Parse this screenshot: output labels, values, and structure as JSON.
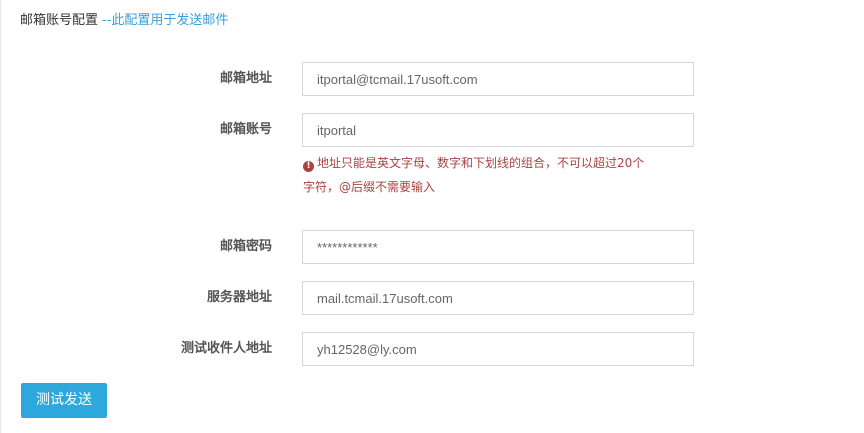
{
  "header": {
    "title": "邮箱账号配置",
    "subtitle": "--此配置用于发送邮件"
  },
  "form": {
    "email_address": {
      "label": "邮箱地址",
      "value": "itportal@tcmail.17usoft.com"
    },
    "email_account": {
      "label": "邮箱账号",
      "value": "itportal",
      "error_line1": "地址只能是英文字母、数字和下划线的组合，不可以超过20个",
      "error_line2": "字符，@后缀不需要输入"
    },
    "email_password": {
      "label": "邮箱密码",
      "value": "************"
    },
    "server_address": {
      "label": "服务器地址",
      "value": "mail.tcmail.17usoft.com"
    },
    "test_recipient": {
      "label": "测试收件人地址",
      "value": "yh12528@ly.com"
    }
  },
  "actions": {
    "test_send_label": "测试发送"
  },
  "colors": {
    "accent": "#2ea8dc",
    "subtitle": "#3a9fd9",
    "error": "#a94442"
  }
}
